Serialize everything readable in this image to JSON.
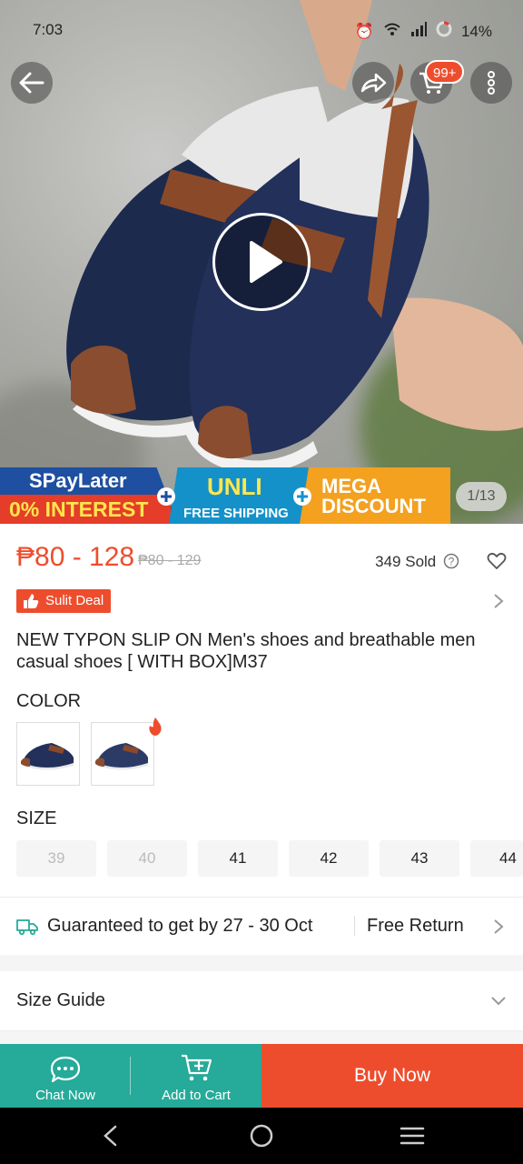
{
  "status_bar": {
    "time": "7:03",
    "battery": "14%"
  },
  "header": {
    "cart_badge": "99+"
  },
  "media": {
    "image_counter": "1/13"
  },
  "promo_banner": {
    "spaylater": "SPayLater",
    "interest": "0% INTEREST",
    "unli": "UNLI",
    "free_shipping": "FREE SHIPPING",
    "mega": "MEGA",
    "discount": "DISCOUNT"
  },
  "product": {
    "price_range": "₱80 - 128",
    "original_price": "₱80 - 129",
    "sold": "349 Sold",
    "deal_badge": "Sulit Deal",
    "title": "NEW TYPON SLIP ON  Men's  shoes and breathable men casual shoes [ WITH BOX]M37"
  },
  "color": {
    "label": "COLOR"
  },
  "size": {
    "label": "SIZE",
    "options": [
      {
        "label": "39",
        "available": false
      },
      {
        "label": "40",
        "available": false
      },
      {
        "label": "41",
        "available": true
      },
      {
        "label": "42",
        "available": true
      },
      {
        "label": "43",
        "available": true
      },
      {
        "label": "44",
        "available": true
      }
    ]
  },
  "shipping": {
    "guarantee": "Guaranteed to get by 27 - 30 Oct",
    "free_return": "Free Return"
  },
  "size_guide": {
    "label": "Size Guide"
  },
  "bottom_bar": {
    "chat_now": "Chat Now",
    "add_to_cart": "Add to Cart",
    "buy_now": "Buy Now"
  },
  "colors": {
    "brand": "#ee4d2d",
    "teal": "#26aa99"
  }
}
